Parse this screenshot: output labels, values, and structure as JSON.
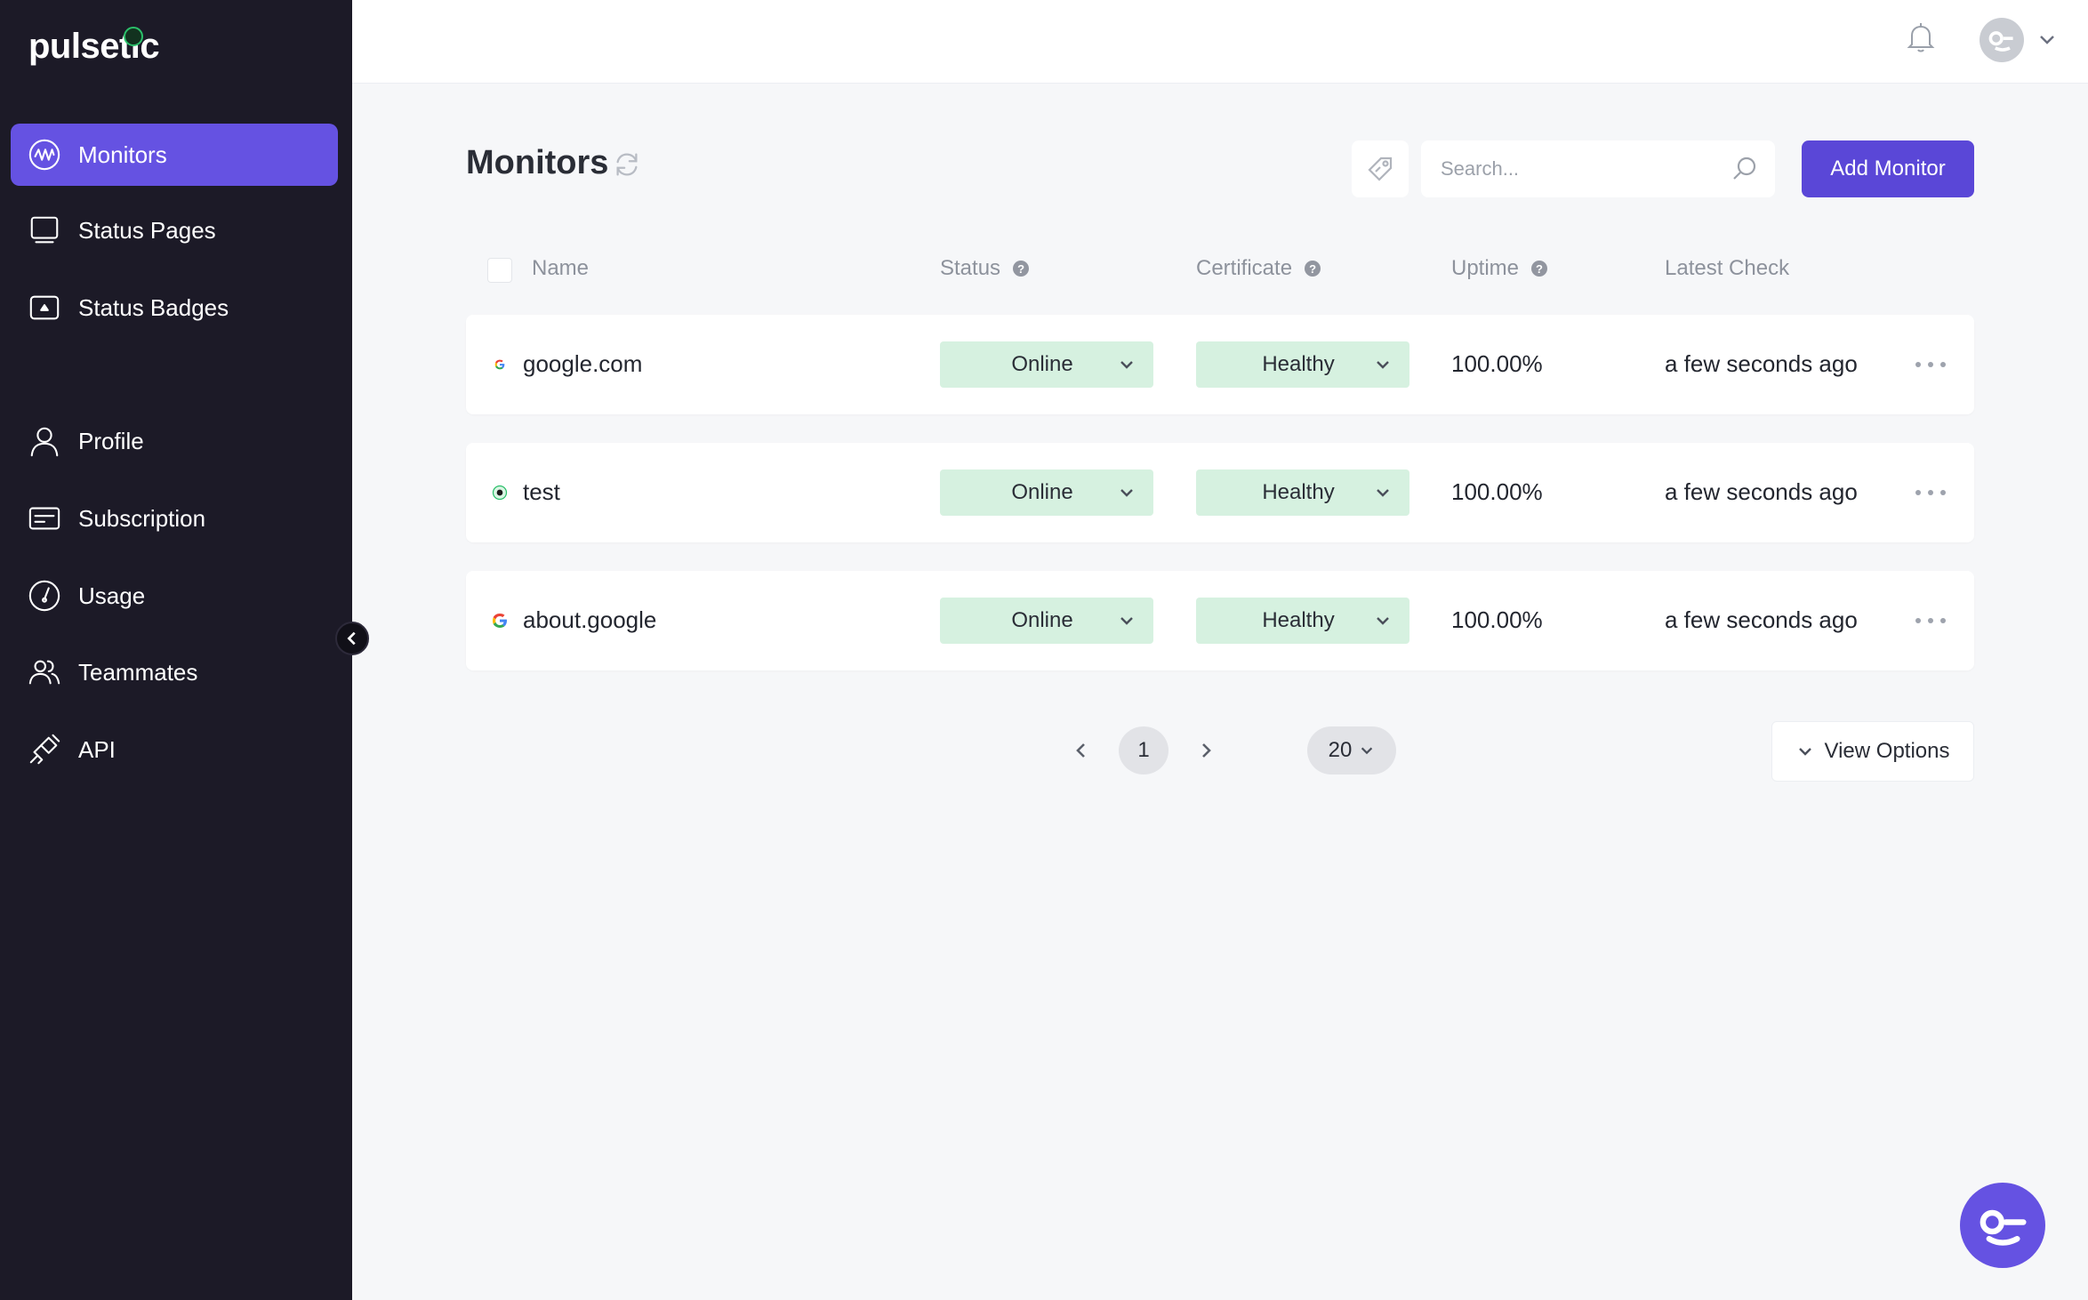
{
  "app": {
    "brand": "pulsetic"
  },
  "sidebar": {
    "items": [
      {
        "label": "Monitors",
        "icon": "monitor-pulse-icon",
        "active": true
      },
      {
        "label": "Status Pages",
        "icon": "screen-icon",
        "active": false
      },
      {
        "label": "Status Badges",
        "icon": "badge-icon",
        "active": false
      },
      {
        "label": "Profile",
        "icon": "user-icon",
        "active": false
      },
      {
        "label": "Subscription",
        "icon": "card-icon",
        "active": false
      },
      {
        "label": "Usage",
        "icon": "gauge-icon",
        "active": false
      },
      {
        "label": "Teammates",
        "icon": "users-icon",
        "active": false
      },
      {
        "label": "API",
        "icon": "plug-icon",
        "active": false
      }
    ]
  },
  "main": {
    "title": "Monitors",
    "search": {
      "placeholder": "Search...",
      "value": ""
    },
    "add_button": "Add Monitor",
    "columns": {
      "name": "Name",
      "status": "Status",
      "certificate": "Certificate",
      "uptime": "Uptime",
      "latest_check": "Latest Check"
    },
    "help_glyph": "?",
    "rows": [
      {
        "name": "google.com",
        "favicon": "google-favicon-icon",
        "status": "Online",
        "certificate": "Healthy",
        "uptime": "100.00%",
        "latest_check": "a few seconds ago"
      },
      {
        "name": "test",
        "favicon": "green-dot-icon",
        "status": "Online",
        "certificate": "Healthy",
        "uptime": "100.00%",
        "latest_check": "a few seconds ago"
      },
      {
        "name": "about.google",
        "favicon": "google-favicon-icon",
        "status": "Online",
        "certificate": "Healthy",
        "uptime": "100.00%",
        "latest_check": "a few seconds ago"
      }
    ],
    "pagination": {
      "current_page": "1",
      "page_size": "20"
    },
    "view_options": "View Options"
  },
  "colors": {
    "sidebar_bg": "#1c1a27",
    "accent": "#6552e2",
    "button_primary": "#5a47d7",
    "status_pill": "#d6f1e0",
    "page_bg": "#f6f7f9"
  }
}
